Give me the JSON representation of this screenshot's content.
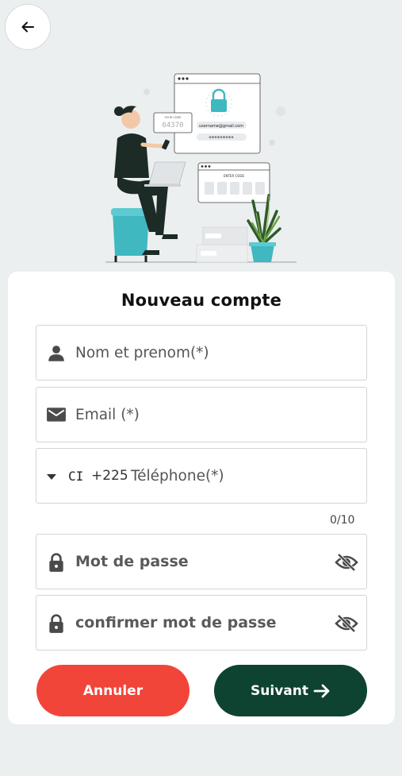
{
  "icons": {
    "back": "arrow-left-icon",
    "name": "person-icon",
    "email": "mail-icon",
    "phone_dropdown": "caret-down-icon",
    "password": "lock-icon",
    "visibility": "eye-off-icon",
    "next": "arrow-right-icon"
  },
  "illustration": {
    "code_label": "YOUR CODE",
    "code_value": "64370",
    "username_text": "username@gmail.com",
    "password_mask": "*********",
    "enter_code_label": "ENTER CODE"
  },
  "form": {
    "title": "Nouveau compte",
    "name_placeholder": "Nom et prenom(*)",
    "email_placeholder": "Email (*)",
    "phone": {
      "country_code": "CI",
      "dial_code": "+225",
      "placeholder": "Téléphone(*)",
      "counter": "0/10"
    },
    "password_placeholder": "Mot de passe",
    "confirm_placeholder": "confirmer mot de passe"
  },
  "buttons": {
    "cancel": "Annuler",
    "next": "Suivant"
  },
  "colors": {
    "background": "#ebeff0",
    "cancel": "#f2453a",
    "next": "#0e4331",
    "accent_teal": "#3fb8c0"
  }
}
